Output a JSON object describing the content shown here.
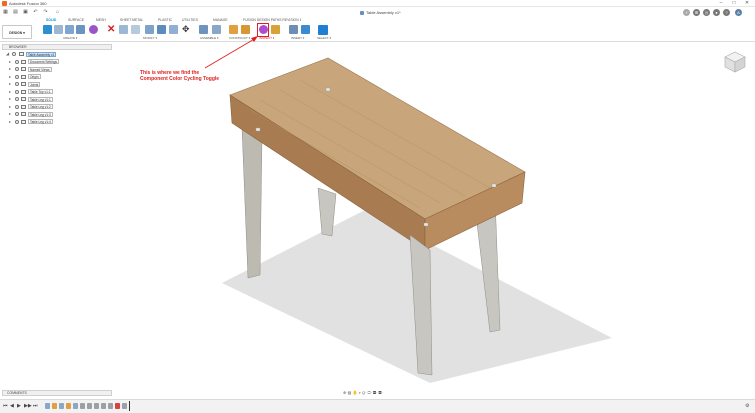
{
  "app": {
    "title": "Autodesk Fusion 360",
    "document_tab": "Table Assembly v1*"
  },
  "window_controls": [
    "–",
    "□",
    "✕"
  ],
  "workspace_switch": {
    "label": "DESIGN ▾"
  },
  "workspace_tabs": [
    "SOLID",
    "SURFACE",
    "MESH",
    "SHEET METAL",
    "PLASTIC",
    "UTILITIES",
    "MANAGE",
    "FUSION DESIGN PATHS REVISION 1"
  ],
  "toolbar_groups": [
    "CREATE ▾",
    "MODIFY ▾",
    "ASSEMBLE ▾",
    "CONSTRUCT ▾",
    "INSPECT ▾",
    "INSERT ▾",
    "SELECT ▾"
  ],
  "annotation": {
    "line1": "This is where we find the",
    "line2": "Component Color Cycling Toggle",
    "color": "#e02020"
  },
  "browser": {
    "header": "BROWSER",
    "items": [
      {
        "label": "Table Assembly v1",
        "icon": "document-icon",
        "root": true
      },
      {
        "label": "Document Settings",
        "icon": "gear-icon"
      },
      {
        "label": "Named Views",
        "icon": "folder-icon"
      },
      {
        "label": "Origin",
        "icon": "folder-icon"
      },
      {
        "label": "Joints",
        "icon": "folder-icon"
      },
      {
        "label": "Table Top v1:1",
        "icon": "component-icon"
      },
      {
        "label": "Table Leg v1:1",
        "icon": "component-icon"
      },
      {
        "label": "Table Leg v1:2",
        "icon": "component-icon"
      },
      {
        "label": "Table Leg v1:3",
        "icon": "component-icon"
      },
      {
        "label": "Table Leg v1:4",
        "icon": "component-icon"
      }
    ]
  },
  "comments": {
    "label": "COMMENTS"
  },
  "nav_bar": {
    "icons": "⊕·▤ ✋ ⌕ Q· ▢· ▦· ▦·"
  },
  "timeline": {
    "controls": [
      "⏮",
      "◀",
      "▶",
      "▶▶",
      "⏭"
    ]
  },
  "colors": {
    "accent": "#0696d7",
    "wood": "#c49a6c",
    "leg": "#c8c6c0",
    "highlight": "#e02020"
  }
}
